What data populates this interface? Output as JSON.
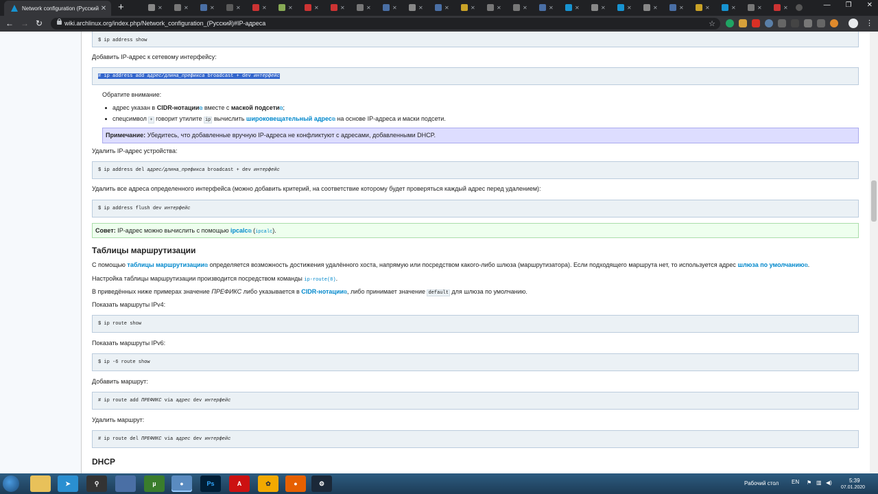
{
  "browser": {
    "active_tab_title": "Network configuration (Русский)",
    "url": "wiki.archlinux.org/index.php/Network_configuration_(Русский)#IP-адреса"
  },
  "article": {
    "code_show": "$ ip address show",
    "add_intro": "Добавить IP-адрес к сетевому интерфейсу:",
    "code_add_prefix": "# ip address add ",
    "code_add_addr": "адрес/длина_префикса",
    "code_add_mid": " broadcast + dev ",
    "code_add_iface": "интерфейс",
    "notice_title": "Обратите внимание:",
    "bullet1_pre": "адрес указан в ",
    "bullet1_bold1": "CIDR-нотации",
    "bullet1_mid": " вместе с ",
    "bullet1_bold2": "маской подсети",
    "bullet1_post": ";",
    "bullet2_pre": "спецсимвол ",
    "bullet2_code1": "+",
    "bullet2_mid1": " говорит утилите ",
    "bullet2_code2": "ip",
    "bullet2_mid2": " вычислить ",
    "bullet2_link": "широковещательный адрес",
    "bullet2_post": " на основе IP-адреса и маски подсети.",
    "note_label": "Примечание:",
    "note_text": " Убедитесь, что добавленные вручную IP-адреса не конфликтуют с адресами, добавленными DHCP.",
    "del_intro": "Удалить IP-адрес устройства:",
    "code_del_prefix": "$ ip address del ",
    "code_del_addr": "адрес/длина_префикса",
    "code_del_mid": " broadcast + dev ",
    "code_del_iface": "интерфейс",
    "flush_intro": "Удалить все адреса определенного интерфейса (можно добавить критерий, на соответствие которому будет проверяться каждый адрес перед удалением):",
    "code_flush_prefix": "$ ip address flush dev ",
    "code_flush_iface": "интерфейс",
    "tip_label": "Совет:",
    "tip_text": " IP-адрес можно вычислить с помощью ",
    "tip_link": "ipcalc",
    "tip_pkg_open": " (",
    "tip_pkg": "ipcalc",
    "tip_pkg_close": ").",
    "routing_heading": "Таблицы маршрутизации",
    "routing_p1_pre": "С помощью ",
    "routing_p1_link1": "таблицы маршрутизации",
    "routing_p1_mid": " определяется возможность достижения удалённого хоста, напрямую или посредством какого-либо шлюза (маршрутизатора). Если подходящего маршрута нет, то используется адрес ",
    "routing_p1_link2": "шлюза по умолчанию",
    "routing_p1_post": ".",
    "routing_p2_pre": "Настройка таблицы маршрутизации производится посредством команды ",
    "routing_p2_code": "ip-route(8)",
    "routing_p2_post": ".",
    "routing_p3_pre": "В приведённых ниже примерах значение ",
    "routing_p3_em": "ПРЕФИКС",
    "routing_p3_mid1": " либо указывается в ",
    "routing_p3_link": "CIDR-нотации",
    "routing_p3_mid2": ", либо принимает значение ",
    "routing_p3_code": "default",
    "routing_p3_post": " для шлюза по умолчанию.",
    "ipv4_intro": "Показать маршруты IPv4:",
    "code_ipv4": "$ ip route show",
    "ipv6_intro": "Показать маршруты IPv6:",
    "code_ipv6": "$ ip -6 route show",
    "addroute_intro": "Добавить маршрут:",
    "code_addroute_pre": "# ip route add ",
    "code_addroute_prefix": "ПРЕФИКС",
    "code_addroute_via": " via ",
    "code_addroute_addr": "адрес",
    "code_addroute_dev": " dev ",
    "code_addroute_iface": "интерфейс",
    "delroute_intro": "Удалить маршрут:",
    "code_delroute_pre": "# ip route del ",
    "code_delroute_prefix": "ПРЕФИКС",
    "code_delroute_via": " via ",
    "code_delroute_addr": "адрес",
    "code_delroute_dev": " dev ",
    "code_delroute_iface": "интерфейс",
    "dhcp_heading": "DHCP"
  },
  "taskbar": {
    "desktop_label": "Рабочий стол",
    "lang": "EN",
    "time": "5:39",
    "date": "07.01.2020"
  }
}
